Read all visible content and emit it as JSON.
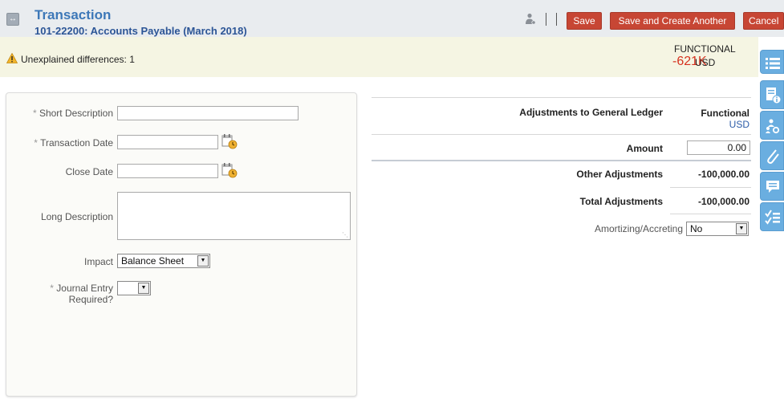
{
  "header": {
    "title": "Transaction",
    "subtitle": "101-22200: Accounts Payable (March 2018)",
    "save_label": "Save",
    "save_create_label": "Save and Create Another",
    "cancel_label": "Cancel"
  },
  "banner": {
    "warning_text": "Unexplained differences: 1",
    "functional_label": "FUNCTIONAL",
    "functional_value": "-621K",
    "functional_currency": "USD"
  },
  "form": {
    "short_description_label": "Short Description",
    "short_description_value": "",
    "transaction_date_label": "Transaction Date",
    "transaction_date_value": "",
    "close_date_label": "Close Date",
    "close_date_value": "",
    "long_description_label": "Long Description",
    "long_description_value": "",
    "impact_label": "Impact",
    "impact_value": "Balance Sheet",
    "journal_entry_label_line1": "Journal Entry",
    "journal_entry_label_line2": "Required?",
    "journal_entry_value": ""
  },
  "adjustments": {
    "heading": "Adjustments to General Ledger",
    "column_header": "Functional",
    "column_currency": "USD",
    "amount_label": "Amount",
    "amount_value": "0.00",
    "other_label": "Other Adjustments",
    "other_value": "-100,000.00",
    "total_label": "Total Adjustments",
    "total_value": "-100,000.00",
    "amortizing_label": "Amortizing/Accreting",
    "amortizing_value": "No"
  },
  "side_rail": [
    "list-icon",
    "info-icon",
    "users-gear-icon",
    "paperclip-icon",
    "comment-icon",
    "checklist-icon"
  ],
  "colors": {
    "accent_button": "#c74634",
    "title_blue": "#3d78b8",
    "warning_red": "#d6321f",
    "rail_blue": "#6aaee0"
  }
}
